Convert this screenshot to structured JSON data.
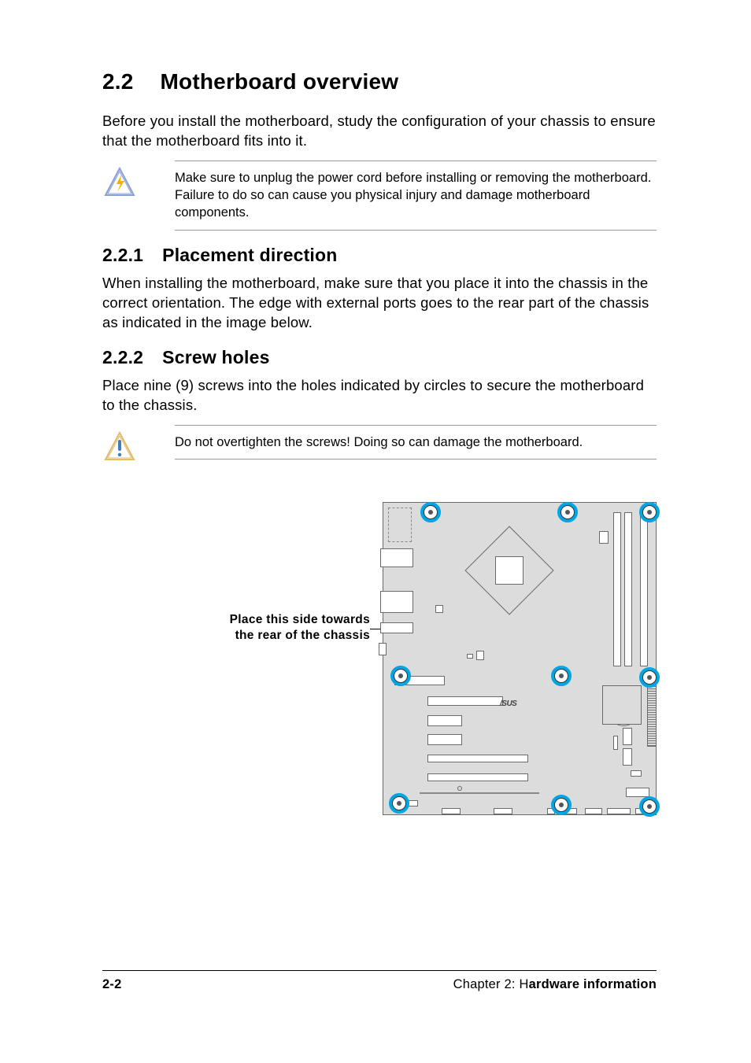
{
  "heading": {
    "number": "2.2",
    "title": "Motherboard overview"
  },
  "intro": "Before you install the motherboard, study the configuration of your chassis to ensure that the motherboard fits into it.",
  "callout1": "Make sure to unplug the power cord before installing or removing the motherboard. Failure to do so can cause you physical injury and damage motherboard components.",
  "sub1": {
    "number": "2.2.1",
    "title": "Placement direction"
  },
  "p1": "When installing the motherboard, make sure that you place it into the chassis in the correct orientation. The edge with external ports goes to the rear part of the chassis as indicated in the image below.",
  "sub2": {
    "number": "2.2.2",
    "title": "Screw holes"
  },
  "p2": "Place nine (9) screws into the holes indicated by circles to secure the motherboard to the chassis.",
  "callout2": "Do not overtighten the screws! Doing so can damage the motherboard.",
  "diagram_label": {
    "line1": "Place this side towards",
    "line2": "the rear of the chassis"
  },
  "board_brand": "/SUS",
  "footer": {
    "page": "2-2",
    "chapter_prefix": "Chapter 2: H",
    "chapter_rest": "ardware information"
  }
}
